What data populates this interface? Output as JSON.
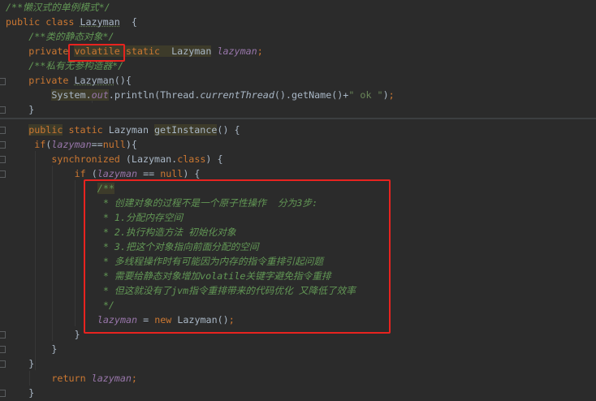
{
  "editor": {
    "lines": [
      {
        "indent": 0,
        "tokens": [
          [
            "cm",
            "/**懒汉式的单例模式*/"
          ]
        ]
      },
      {
        "indent": 0,
        "tokens": [
          [
            "kw",
            "public class "
          ],
          [
            "uline",
            "Lazyman"
          ],
          [
            "",
            "  {"
          ]
        ]
      },
      {
        "indent": 4,
        "tokens": [
          [
            "cm",
            "/**类的静态对象*/"
          ]
        ]
      },
      {
        "indent": 4,
        "tokens": [
          [
            "kw",
            "private "
          ],
          [
            "kw hl",
            "volatile"
          ],
          [
            "kw hl",
            " static  "
          ],
          [
            "hl",
            "Lazyman"
          ],
          [
            "",
            " "
          ],
          [
            "fld",
            "lazyman"
          ],
          [
            "kw",
            ";"
          ]
        ]
      },
      {
        "indent": 4,
        "tokens": [
          [
            "cm",
            "/**私有无参构造器*/"
          ]
        ]
      },
      {
        "indent": 4,
        "tokens": [
          [
            "kw",
            "private "
          ],
          [
            "uline",
            "Lazyman"
          ],
          [
            "",
            "(){"
          ]
        ]
      },
      {
        "indent": 8,
        "tokens": [
          [
            "hl",
            "System."
          ],
          [
            "fld hl",
            "out"
          ],
          [
            "",
            ".println(Thread."
          ],
          [
            "ital",
            "currentThread"
          ],
          [
            "",
            "().getName()+"
          ],
          [
            "str",
            "\" ok \""
          ],
          [
            "",
            ")"
          ],
          [
            "kw",
            ";"
          ]
        ]
      },
      {
        "indent": 4,
        "tokens": [
          [
            "",
            "}"
          ]
        ]
      },
      {
        "indent": 4,
        "tokens": [
          [
            "kw hl",
            "public"
          ],
          [
            "kw",
            " static "
          ],
          [
            "",
            "Lazyman "
          ],
          [
            "hl",
            "getInstance"
          ],
          [
            "",
            "() {"
          ]
        ]
      },
      {
        "indent": 5,
        "tokens": [
          [
            "kw",
            "if"
          ],
          [
            "",
            "("
          ],
          [
            "fld",
            "lazyman"
          ],
          [
            "",
            "=="
          ],
          [
            "kw",
            "null"
          ],
          [
            "",
            "){"
          ]
        ]
      },
      {
        "indent": 8,
        "tokens": [
          [
            "kw",
            "synchronized "
          ],
          [
            "",
            "(Lazyman."
          ],
          [
            "kw",
            "class"
          ],
          [
            "",
            ") {"
          ]
        ]
      },
      {
        "indent": 12,
        "tokens": [
          [
            "kw",
            "if "
          ],
          [
            "",
            "("
          ],
          [
            "fld",
            "lazyman"
          ],
          [
            "",
            " == "
          ],
          [
            "kw",
            "null"
          ],
          [
            "",
            ") {"
          ]
        ]
      },
      {
        "indent": 16,
        "tokens": [
          [
            "cm hl",
            "/**"
          ]
        ]
      },
      {
        "indent": 17,
        "tokens": [
          [
            "cm",
            "* 创建对象的过程不是一个原子性操作  分为3步:"
          ]
        ]
      },
      {
        "indent": 17,
        "tokens": [
          [
            "cm",
            "* 1.分配内存空间"
          ]
        ]
      },
      {
        "indent": 17,
        "tokens": [
          [
            "cm",
            "* 2.执行构造方法 初始化对象"
          ]
        ]
      },
      {
        "indent": 17,
        "tokens": [
          [
            "cm",
            "* 3.把这个对象指向前面分配的空间"
          ]
        ]
      },
      {
        "indent": 17,
        "tokens": [
          [
            "cm",
            "* 多线程操作时有可能因为内存的指令重排引起问题"
          ]
        ]
      },
      {
        "indent": 17,
        "tokens": [
          [
            "cm",
            "* 需要给静态对象增加volatile关键字避免指令重排"
          ]
        ]
      },
      {
        "indent": 17,
        "tokens": [
          [
            "cm",
            "* 但这就没有了jvm指令重排带来的代码优化 又降低了效率"
          ]
        ]
      },
      {
        "indent": 17,
        "tokens": [
          [
            "cm",
            "*/"
          ]
        ]
      },
      {
        "indent": 16,
        "tokens": [
          [
            "fld",
            "lazyman"
          ],
          [
            "",
            " = "
          ],
          [
            "kw",
            "new "
          ],
          [
            "",
            "Lazyman()"
          ],
          [
            "kw",
            ";"
          ]
        ]
      },
      {
        "indent": 12,
        "tokens": [
          [
            "",
            "}"
          ]
        ]
      },
      {
        "indent": 8,
        "tokens": [
          [
            "",
            "}"
          ]
        ]
      },
      {
        "indent": 4,
        "tokens": [
          [
            "",
            "}"
          ]
        ]
      },
      {
        "indent": 8,
        "tokens": [
          [
            "kw",
            "return "
          ],
          [
            "fld",
            "lazyman"
          ],
          [
            "kw",
            ";"
          ]
        ]
      },
      {
        "indent": 4,
        "tokens": [
          [
            "",
            "}"
          ]
        ]
      }
    ]
  }
}
